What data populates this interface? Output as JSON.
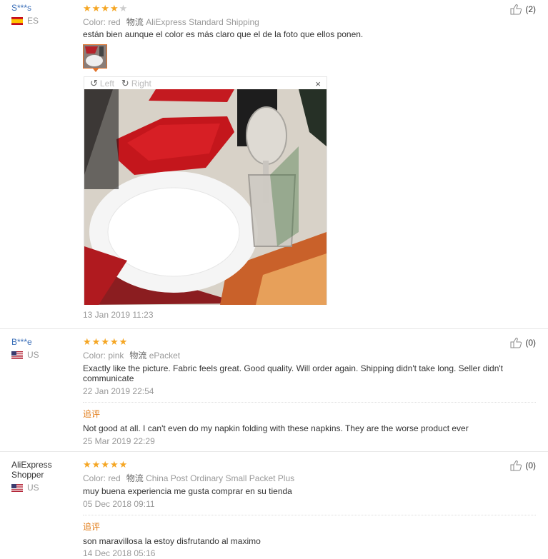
{
  "reviews": [
    {
      "user": "S***s",
      "country": "ES",
      "stars": 4,
      "color_label": "Color:",
      "color_value": "red",
      "shipping_label": "物流",
      "shipping_value": "AliExpress Standard Shipping",
      "text": "están bien aunque el color es más claro que el de la foto que ellos ponen.",
      "date": "13 Jan 2019 11:23",
      "helpful": "(2)"
    },
    {
      "user": "B***e",
      "country": "US",
      "stars": 5,
      "color_label": "Color:",
      "color_value": "pink",
      "shipping_label": "物流",
      "shipping_value": "ePacket",
      "text": "Exactly like the picture. Fabric feels great. Good quality. Will order again. Shipping didn't take long. Seller didn't communicate",
      "date": "22 Jan 2019 22:54",
      "helpful": "(0)",
      "followup_label": "追评",
      "followup_text": "Not good at all. I can't even do my napkin folding with these napkins. They are the worse product ever",
      "followup_date": "25 Mar 2019 22:29"
    },
    {
      "user": "AliExpress Shopper",
      "country": "US",
      "stars": 5,
      "color_label": "Color:",
      "color_value": "red",
      "shipping_label": "物流",
      "shipping_value": "China Post Ordinary Small Packet Plus",
      "text": "muy buena experiencia me gusta comprar en su tienda",
      "date": "05 Dec 2018 09:11",
      "helpful": "(0)",
      "followup_label": "追评",
      "followup_text": "son maravillosa la estoy disfrutando al maximo",
      "followup_date": "14 Dec 2018 05:16"
    }
  ],
  "viewer": {
    "left_label": "Left",
    "right_label": "Right",
    "close": "×"
  },
  "colors": {
    "star": "#f5a623",
    "followup": "#e27c17",
    "username_link": "#3b6fb8",
    "thumb_border": "#e0722a"
  }
}
